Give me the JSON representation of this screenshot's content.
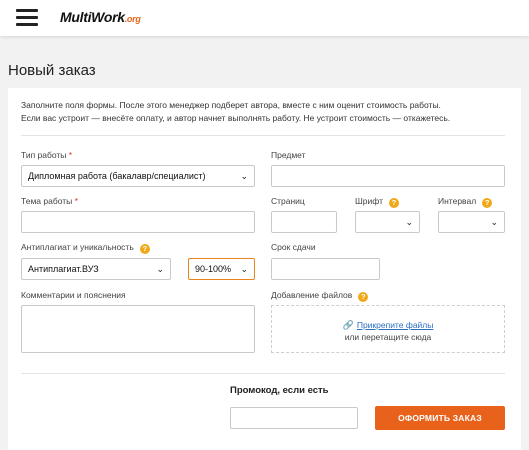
{
  "header": {
    "logo": {
      "part1": "Multi",
      "part2": "Work",
      "part3": ".org"
    }
  },
  "page": {
    "title": "Новый заказ"
  },
  "intro": {
    "line1": "Заполните поля формы. После этого менеджер подберет автора, вместе с ним оценит стоимость работы.",
    "line2": "Если вас устроит — внесёте оплату, и автор начнет выполнять работу. Не устроит стоимость — откажетесь."
  },
  "form": {
    "work_type": {
      "label": "Тип работы",
      "required_mark": "*",
      "value": "Дипломная работа (бакалавр/специалист)"
    },
    "subject": {
      "label": "Предмет",
      "value": ""
    },
    "topic": {
      "label": "Тема работы",
      "required_mark": "*",
      "value": ""
    },
    "pages": {
      "label": "Страниц",
      "value": ""
    },
    "font": {
      "label": "Шрифт",
      "value": ""
    },
    "interval": {
      "label": "Интервал",
      "value": ""
    },
    "antiplagiat": {
      "label": "Антиплагиат и уникальность",
      "system_value": "Антиплагиат.ВУЗ",
      "percent_value": "90-100%"
    },
    "deadline": {
      "label": "Срок сдачи",
      "value": ""
    },
    "comments": {
      "label": "Комментарии и пояснения",
      "value": ""
    },
    "files": {
      "label": "Добавление файлов",
      "link": "Прикрепите файлы",
      "hint": "или перетащите сюда"
    },
    "promo": {
      "label": "Промокод, если есть",
      "value": ""
    },
    "submit_label": "ОФОРМИТЬ ЗАКАЗ"
  },
  "icons": {
    "help": "?",
    "chevron": "⌄"
  },
  "colors": {
    "accent": "#e8621c",
    "help": "#f0a81a",
    "link": "#2a6fc4",
    "required": "#d9342b"
  }
}
